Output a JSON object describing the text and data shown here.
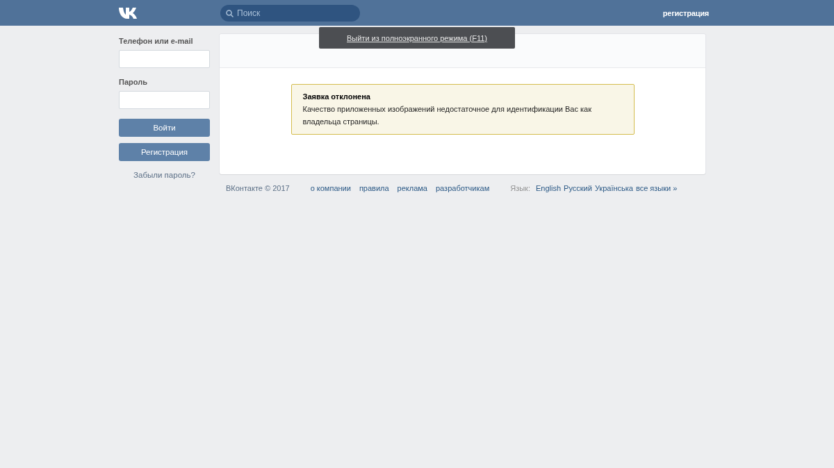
{
  "header": {
    "search": {
      "placeholder": "Поиск"
    },
    "register_link": "регистрация"
  },
  "login": {
    "phone_label": "Телефон или e-mail",
    "password_label": "Пароль",
    "login_button": "Войти",
    "register_button": "Регистрация",
    "forgot_link": "Забыли пароль?"
  },
  "notice": {
    "title": "Заявка отклонена",
    "text": "Качество приложенных изображений недостаточное для идентификации Вас как владельца страницы."
  },
  "footer": {
    "copyright": "ВКонтакте © 2017",
    "links": [
      "о компании",
      "правила",
      "реклама",
      "разработчикам"
    ],
    "language_label": "Язык:",
    "languages": [
      "English",
      "Русский",
      "Українська",
      "все языки »"
    ]
  },
  "fullscreen_tooltip": "Выйти из полноэкранного режима (F11)"
}
